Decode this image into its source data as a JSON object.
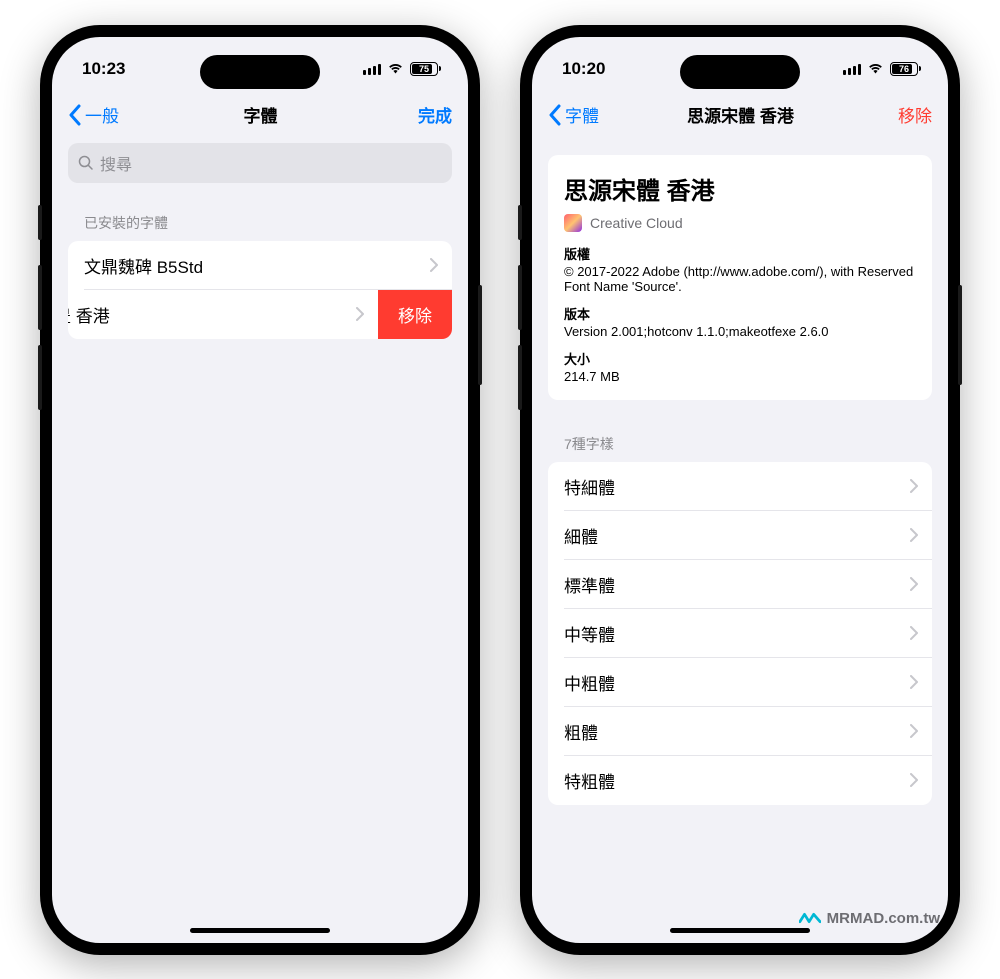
{
  "left": {
    "status": {
      "time": "10:23",
      "battery": "75"
    },
    "nav": {
      "back": "一般",
      "title": "字體",
      "done": "完成"
    },
    "search": {
      "placeholder": "搜尋"
    },
    "sectionHeader": "已安裝的字體",
    "fonts": [
      {
        "name": "文鼎魏碑 B5Std"
      },
      {
        "name": "豊 香港"
      }
    ],
    "deleteLabel": "移除"
  },
  "right": {
    "status": {
      "time": "10:20",
      "battery": "76"
    },
    "nav": {
      "back": "字體",
      "title": "思源宋體 香港",
      "remove": "移除"
    },
    "fontTitle": "思源宋體 香港",
    "appName": "Creative Cloud",
    "copyrightLabel": "版權",
    "copyrightValue": "© 2017-2022 Adobe (http://www.adobe.com/), with Reserved Font Name 'Source'.",
    "versionLabel": "版本",
    "versionValue": "Version 2.001;hotconv 1.1.0;makeotfexe 2.6.0",
    "sizeLabel": "大小",
    "sizeValue": "214.7 MB",
    "stylesHeader": "7種字樣",
    "styles": [
      "特細體",
      "細體",
      "標準體",
      "中等體",
      "中粗體",
      "粗體",
      "特粗體"
    ]
  },
  "watermark": "MRMAD.com.tw"
}
